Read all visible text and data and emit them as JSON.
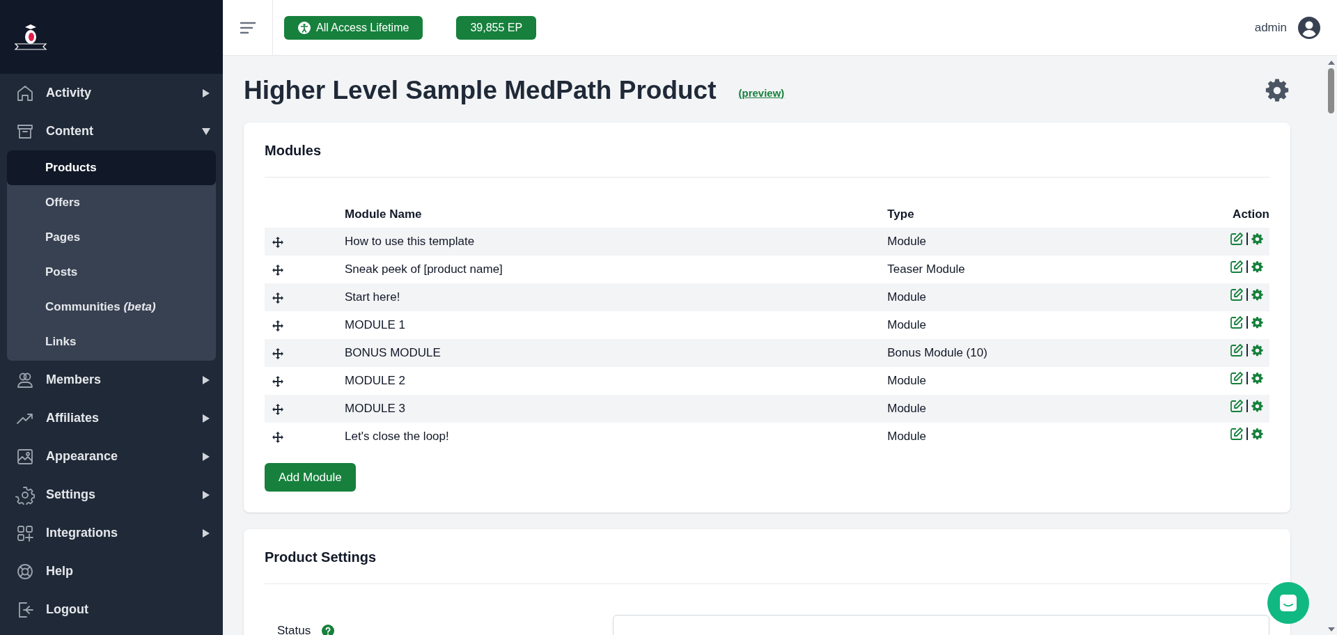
{
  "sidebar": {
    "items": [
      {
        "label": "Activity",
        "expanded": false
      },
      {
        "label": "Content",
        "expanded": true,
        "children": [
          {
            "label": "Products",
            "selected": true
          },
          {
            "label": "Offers",
            "selected": false
          },
          {
            "label": "Pages",
            "selected": false
          },
          {
            "label": "Posts",
            "selected": false
          },
          {
            "label": "Communities *(beta)*",
            "selected": false
          },
          {
            "label": "Links",
            "selected": false
          }
        ]
      },
      {
        "label": "Members",
        "expanded": false
      },
      {
        "label": "Affiliates",
        "expanded": false
      },
      {
        "label": "Appearance",
        "expanded": false
      },
      {
        "label": "Settings",
        "expanded": false
      },
      {
        "label": "Integrations",
        "expanded": false
      },
      {
        "label": "Help"
      },
      {
        "label": "Logout"
      }
    ]
  },
  "header": {
    "badges": [
      "All Access Lifetime",
      "39,855 EP"
    ],
    "user": "admin"
  },
  "page": {
    "title": "Higher Level Sample MedPath Product",
    "preview_link": "(preview)"
  },
  "modules": {
    "title": "Modules",
    "columns": [
      "Module Name",
      "Type",
      "Action"
    ],
    "rows": [
      {
        "name": "How to use this template",
        "type": "Module"
      },
      {
        "name": "Sneak peek of [product name]",
        "type": "Teaser Module"
      },
      {
        "name": "Start here!",
        "type": "Module"
      },
      {
        "name": "MODULE 1",
        "type": "Module"
      },
      {
        "name": "BONUS MODULE",
        "type": "Bonus Module (10)"
      },
      {
        "name": "MODULE 2",
        "type": "Module"
      },
      {
        "name": "MODULE 3",
        "type": "Module"
      },
      {
        "name": "Let's close the loop!",
        "type": "Module"
      }
    ],
    "add_button": "Add Module"
  },
  "product_settings": {
    "title": "Product Settings",
    "fields": [
      {
        "label": "Status"
      }
    ]
  }
}
